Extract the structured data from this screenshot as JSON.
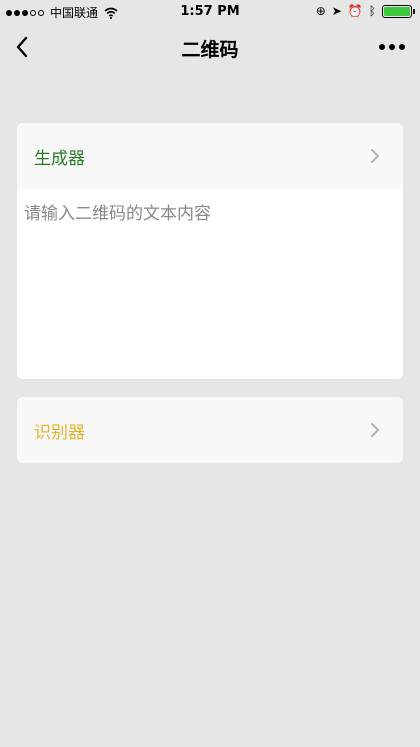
{
  "status_bar": {
    "carrier": "中国联通",
    "time": "1:57 PM"
  },
  "nav": {
    "title": "二维码"
  },
  "generator": {
    "title": "生成器",
    "input_placeholder": "请输入二维码的文本内容",
    "input_value": ""
  },
  "scanner": {
    "title": "识别器"
  },
  "colors": {
    "background": "#e6e6e6",
    "generator_title": "#2a7a2a",
    "scanner_title": "#e6b32e",
    "battery": "#3ec63e"
  },
  "icons": {
    "back": "chevron-left-icon",
    "more": "more-icon",
    "chevron": "chevron-right-icon",
    "wifi": "wifi-icon",
    "battery": "battery-icon"
  }
}
